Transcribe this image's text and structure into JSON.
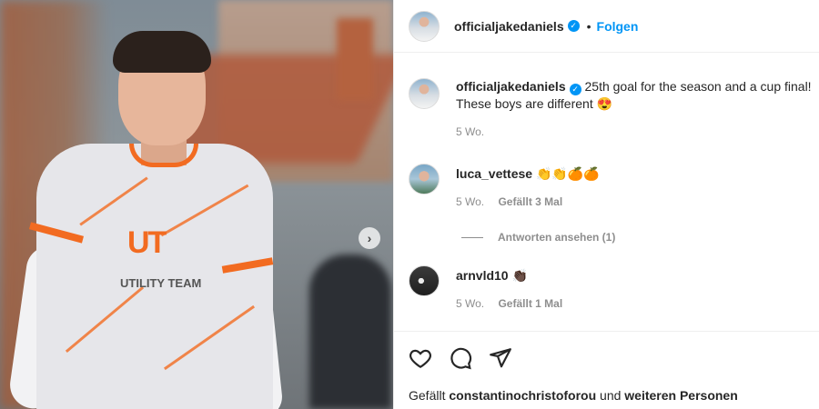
{
  "post": {
    "username": "officialjakedaniels",
    "follow_label": "Folgen",
    "dot": "•",
    "caption_line1": "25th goal for the season and a cup final!",
    "caption_line2": "These boys are different",
    "caption_emoji": "😍",
    "caption_time": "5 Wo."
  },
  "photo": {
    "sponsor_logo": "UT",
    "sponsor_name": "UTILITY TEAM",
    "next_label": "›"
  },
  "comments": [
    {
      "username": "luca_vettese",
      "text": "👏👏🍊🍊",
      "time": "5 Wo.",
      "likes": "Gefällt 3 Mal"
    },
    {
      "username": "arnvld10",
      "text": "👏🏿",
      "time": "5 Wo.",
      "likes": "Gefällt 1 Mal"
    }
  ],
  "replies": {
    "label": "Antworten ansehen (1)"
  },
  "liked_by": {
    "prefix": "Gefällt",
    "user": "constantinochristoforou",
    "middle": "und",
    "suffix": "weiteren Personen"
  },
  "icons": [
    "heart-icon",
    "comment-icon",
    "share-icon"
  ],
  "colors": {
    "accent": "#0095f6",
    "kit_orange": "#f26b21",
    "meta": "#8e8e8e"
  }
}
